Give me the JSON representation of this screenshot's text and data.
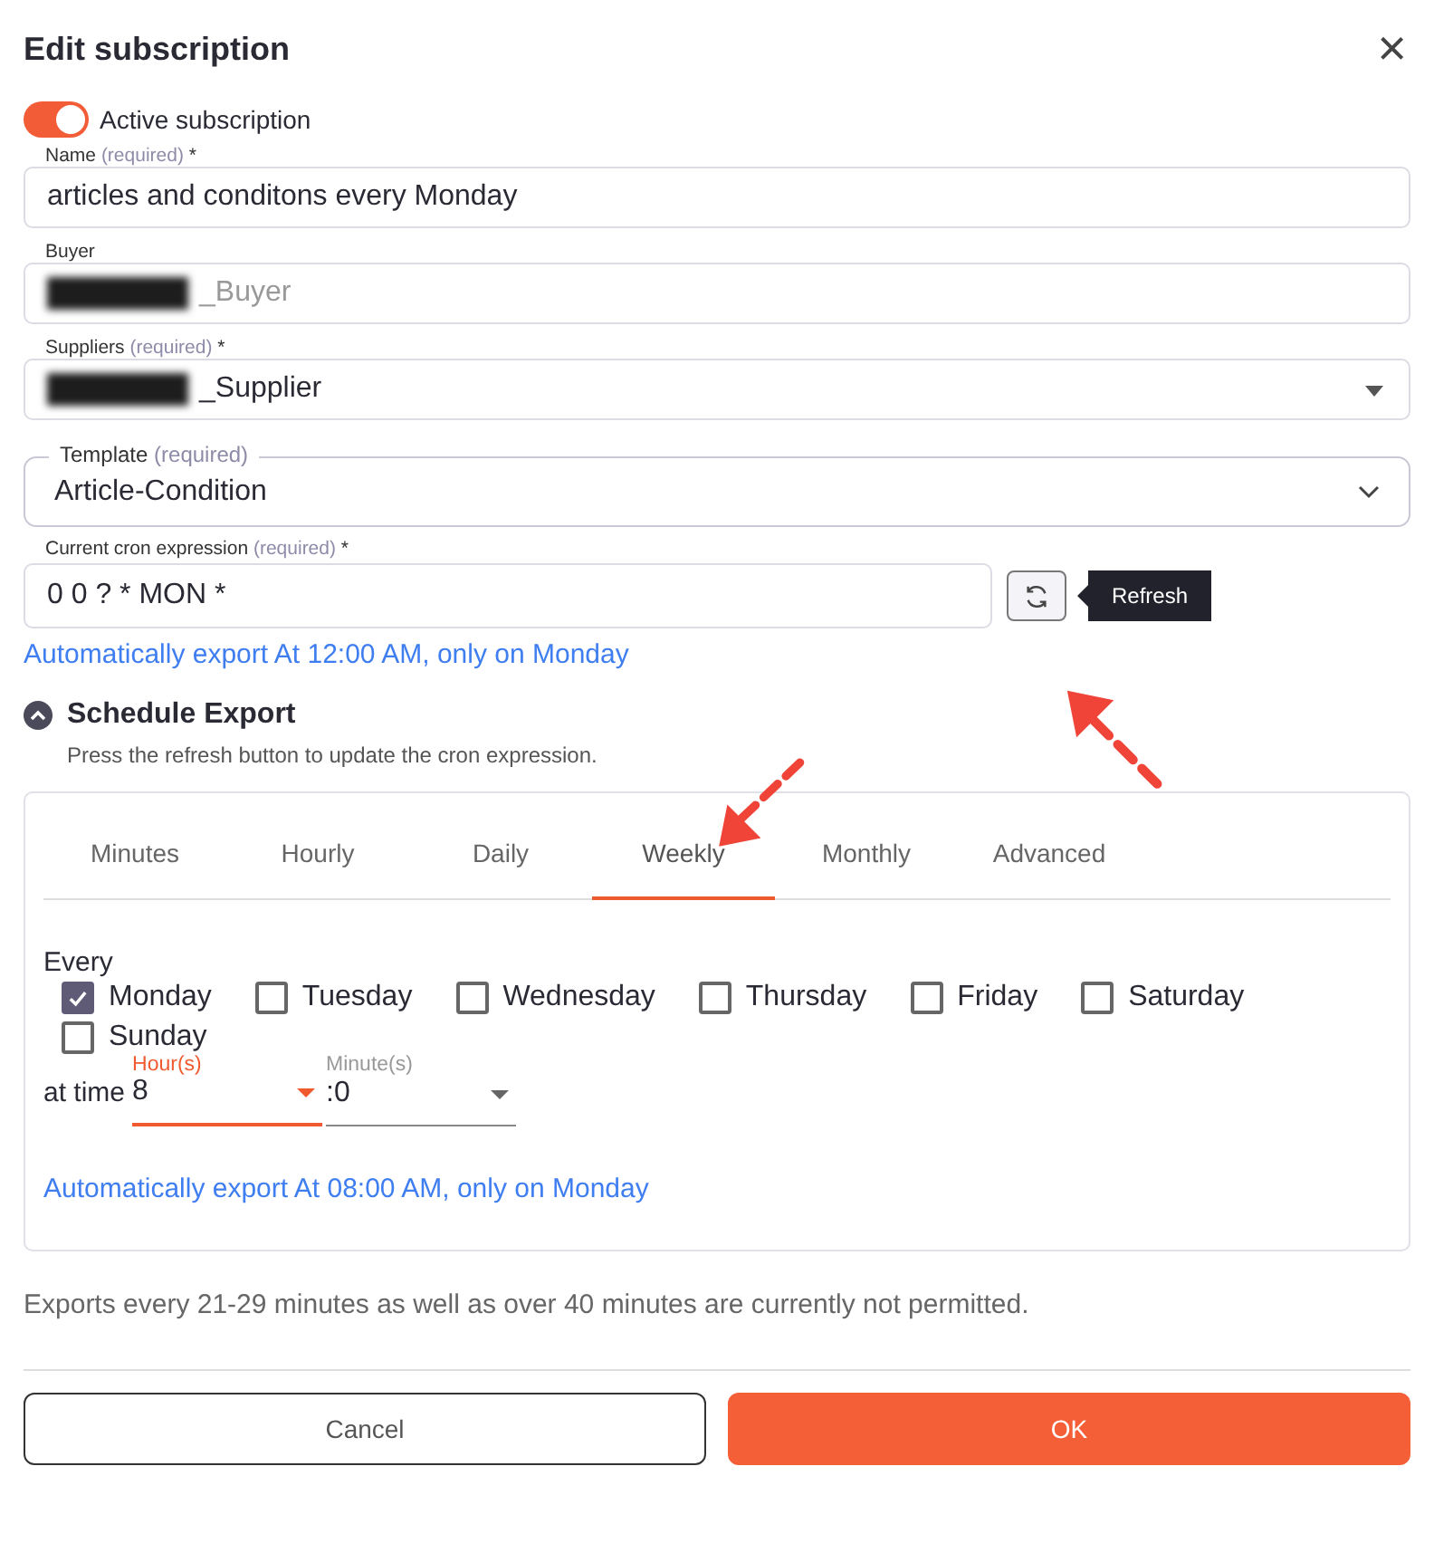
{
  "dialog": {
    "title": "Edit subscription",
    "close": "×"
  },
  "active": {
    "label": "Active subscription",
    "on": true
  },
  "name_field": {
    "label": "Name",
    "required": "(required)",
    "star": "*",
    "value": "articles and conditons every Monday"
  },
  "buyer_field": {
    "label": "Buyer",
    "value": "_Buyer",
    "disabled": true
  },
  "suppliers_field": {
    "label": "Suppliers",
    "required": "(required)",
    "star": "*",
    "value": "_Supplier"
  },
  "template_field": {
    "label": "Template",
    "required": "(required)",
    "value": "Article-Condition"
  },
  "cron_field": {
    "label": "Current cron expression",
    "required": "(required)",
    "star": "*",
    "value": "0 0 ? * MON *"
  },
  "refresh_tooltip": "Refresh",
  "current_summary": "Automatically export At 12:00 AM, only on Monday",
  "schedule": {
    "title": "Schedule Export",
    "expanded": true,
    "hint": "Press the refresh button to update the cron expression."
  },
  "tabs": [
    {
      "label": "Minutes",
      "selected": false
    },
    {
      "label": "Hourly",
      "selected": false
    },
    {
      "label": "Daily",
      "selected": false
    },
    {
      "label": "Weekly",
      "selected": true
    },
    {
      "label": "Monthly",
      "selected": false
    },
    {
      "label": "Advanced",
      "selected": false
    }
  ],
  "every_label": "Every",
  "days": [
    {
      "label": "Monday",
      "checked": true
    },
    {
      "label": "Tuesday",
      "checked": false
    },
    {
      "label": "Wednesday",
      "checked": false
    },
    {
      "label": "Thursday",
      "checked": false
    },
    {
      "label": "Friday",
      "checked": false
    },
    {
      "label": "Saturday",
      "checked": false
    },
    {
      "label": "Sunday",
      "checked": false
    }
  ],
  "time": {
    "prefix": "at time",
    "hour_label": "Hour(s)",
    "hour": "8",
    "hour_focused": true,
    "minute_label": "Minute(s)",
    "minute": ":0",
    "minute_focused": false
  },
  "new_summary": "Automatically export At 08:00 AM, only on Monday",
  "note": "Exports every 21-29 minutes as well as over 40 minutes are currently not permitted.",
  "buttons": [
    {
      "label": "Cancel",
      "kind": "secondary"
    },
    {
      "label": "OK",
      "kind": "primary"
    }
  ]
}
